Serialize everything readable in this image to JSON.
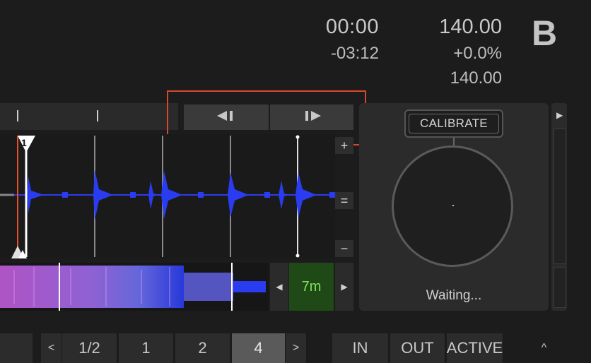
{
  "deck": {
    "letter": "B",
    "time_elapsed": "00:00",
    "time_remaining": "-03:12",
    "bpm": "140.00",
    "pitch": "+0.0%",
    "bpm_base": "140.00"
  },
  "beatjump": {
    "back_icon": "beatjump-back-icon",
    "forward_icon": "beatjump-forward-icon"
  },
  "waveform": {
    "cue_number": "1",
    "zoom_in": "+",
    "zoom_reset": "=",
    "zoom_out": "−"
  },
  "loop": {
    "length": "7m",
    "prev_icon": "chevron-left-icon",
    "next_icon": "chevron-right-icon"
  },
  "platter": {
    "calibrate_label": "CALIBRATE",
    "status": "Waiting..."
  },
  "bottom": {
    "prev": "<",
    "sizes": [
      "1/2",
      "1",
      "2",
      "4"
    ],
    "selected_size": "4",
    "next": ">",
    "in": "IN",
    "out": "OUT",
    "active": "ACTIVE",
    "expand": "^"
  },
  "colors": {
    "accent_highlight": "#d9472a",
    "waveform_blue": "#2a3cf0",
    "loop_green": "#7ee05a",
    "overview_magenta": "#d060e0"
  }
}
